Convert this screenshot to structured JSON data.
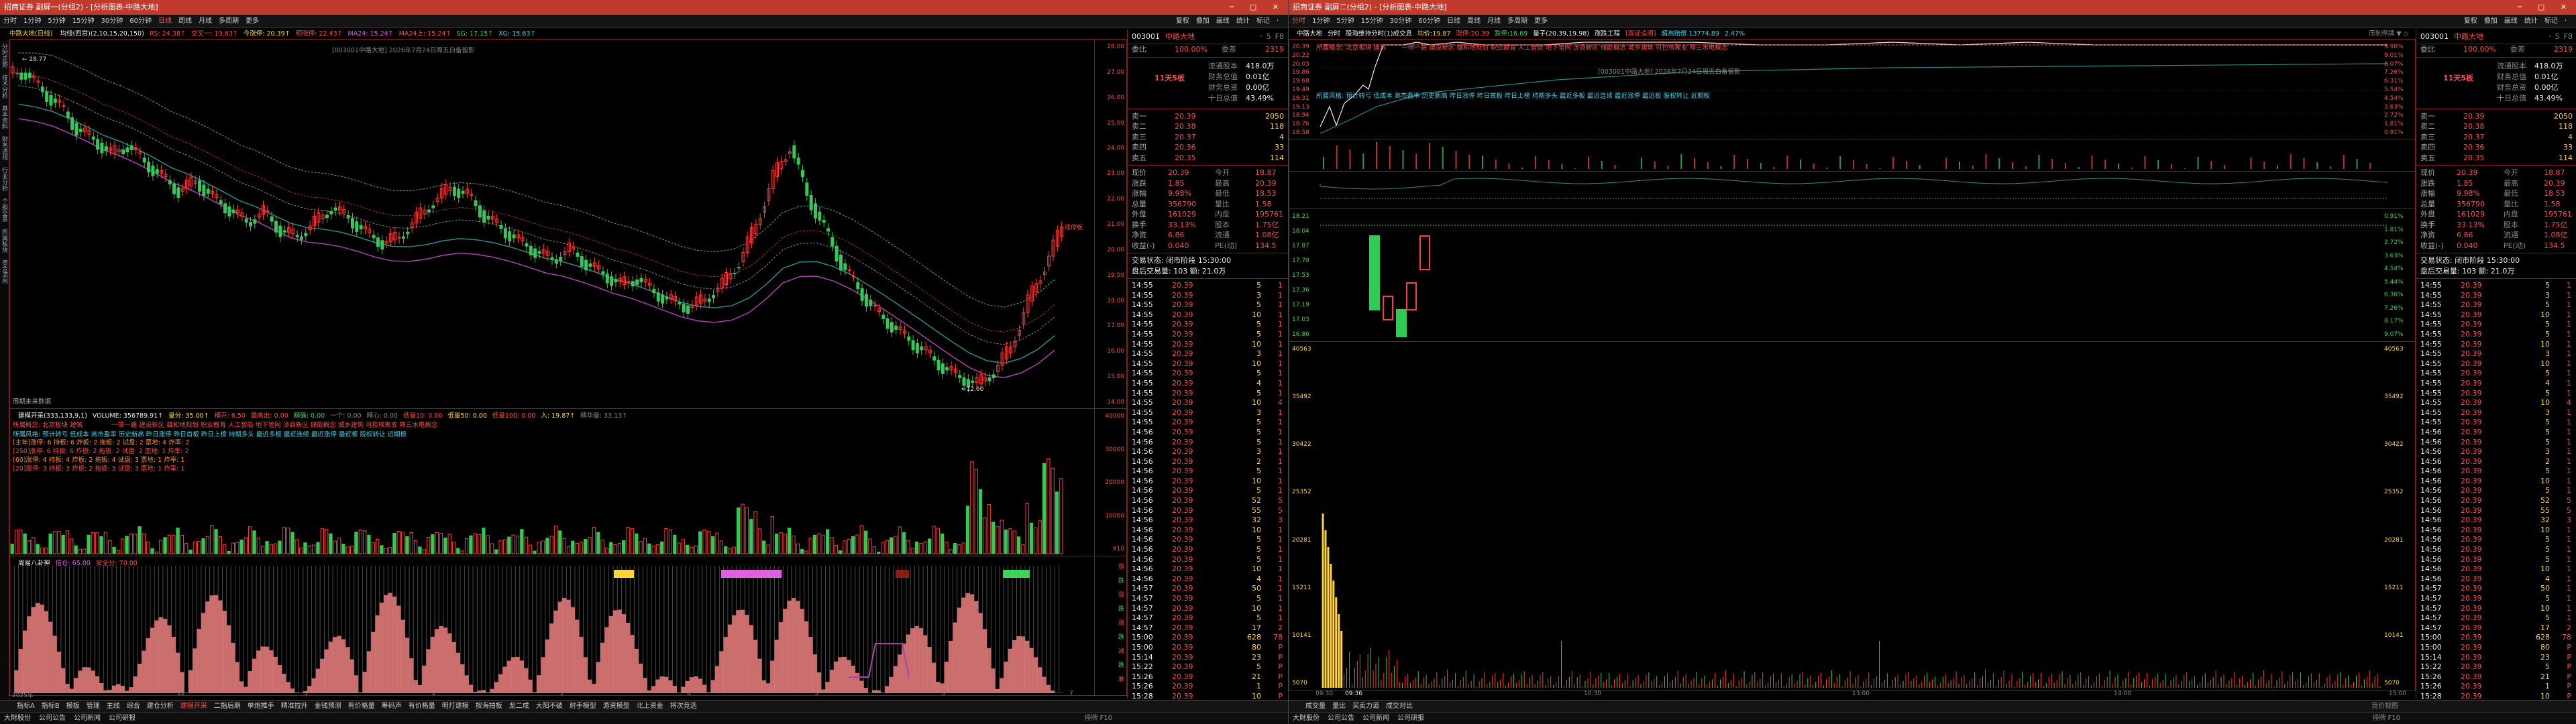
{
  "left": {
    "title": "招商证券 副屏一(分组2) - [分析图表-中路大地]",
    "menu": [
      "分时",
      "1分钟",
      "5分钟",
      "15分钟",
      "30分钟",
      "60分钟",
      "日线",
      "周线",
      "月线",
      "多周期",
      "更多"
    ],
    "menu_active": "日线",
    "menu_right": [
      "复权",
      "叠加",
      "画线",
      "统计",
      "标记",
      "·"
    ],
    "stock_label": "中路大地(日线)",
    "ind_line": [
      {
        "t": "均线(四宫)(2,10,15,20,150)",
        "c": "wht"
      },
      {
        "t": "RS: 24.38↑",
        "c": "red"
      },
      {
        "t": "交叉一: 19.63↑",
        "c": "red"
      },
      {
        "t": "今涨停: 20.39↑",
        "c": "yel"
      },
      {
        "t": "明涨停: 22.43↑",
        "c": "red"
      },
      {
        "t": "MA24: 15.24↑",
        "c": "mag"
      },
      {
        "t": "MA24上: 15.24↑",
        "c": "red"
      },
      {
        "t": "SG: 17.15↑",
        "c": "grn"
      },
      {
        "t": "XG: 15.63↑",
        "c": "cy"
      }
    ],
    "watermark": "[003001中路大地] 2026年7月24日周五白备留影",
    "high_marker": "28.77",
    "low_marker": "12.60",
    "right_marker": "涨停板",
    "no_data": "周期未来数据",
    "price_axis": [
      "28.00",
      "27.00",
      "26.00",
      "25.00",
      "24.00",
      "23.00",
      "22.00",
      "21.00",
      "20.00",
      "19.00",
      "18.00",
      "17.00",
      "16.00",
      "15.00",
      "14.00"
    ],
    "vol_header": [
      {
        "t": "建模开采(333,133,9,1)",
        "c": "wht"
      },
      {
        "t": "VOLUME: 356789.91↑",
        "c": "wht"
      },
      {
        "t": "量分: 35.00↑",
        "c": "yel"
      },
      {
        "t": "横开: 6.50",
        "c": "red"
      },
      {
        "t": "最高出: 0.00",
        "c": "red"
      },
      {
        "t": "精确: 0.00",
        "c": "grn"
      },
      {
        "t": "一个: 0.00",
        "c": "grey"
      },
      {
        "t": "精心: 0.00",
        "c": "grey"
      },
      {
        "t": "低量10: 0.00",
        "c": "red"
      },
      {
        "t": "低量50: 0.00",
        "c": "yel"
      },
      {
        "t": "低量100: 0.00",
        "c": "red"
      },
      {
        "t": "入: 19.87↑",
        "c": "yel"
      },
      {
        "t": "精华量: 33.13↑",
        "c": "grey"
      }
    ],
    "concept_line1": "所属概念: 北京板块   建筑",
    "concept_line1b": "一带一路 建设新区 雄和地规划 职业教育 人工智能 地下管网 涉县新区 储能概念 城乡建筑 可控核聚变 降三水电概念",
    "concept_line2": "所属风格: 预计转亏 低成本 高市盈率 历史新高 昨日涨停 昨日首板 昨日上榜 持期多头 最近多板 最近连续 最近涨停 最近板 股权转让 近期板",
    "stats_rows": [
      "[主年]涨停: 6  持板: 6  炸板: 2  拖板: 2  试盘: 2  票地: 4  炸率: 2",
      "[250]涨停: 6  持板: 6  炸板: 2  拖板: 2  试盘: 2  票地: 1  炸率: 2",
      "[60]涨停: 4  持板: 4  炸板: 2  拖板: 4  试盘: 3  票地: 1  炸率: 1",
      "[20]涨停: 3  持板: 3  炸板: 2  拖板: 3  试盘: 3  票地: 1  炸率: 1"
    ],
    "vol_axis": [
      "40000",
      "30000",
      "20000",
      "10000",
      "X10"
    ],
    "osc_header": [
      {
        "t": "周易八卦神",
        "c": "wht"
      },
      {
        "t": "信仓: 65.00",
        "c": "mag"
      },
      {
        "t": "安全分: 70.00",
        "c": "red"
      }
    ],
    "osc_side_labels": [
      "涨",
      "跌",
      "涨",
      "跌",
      "涨",
      "跌",
      "减",
      "跌",
      "准"
    ],
    "date_axis": [
      "2025年",
      "12",
      "1",
      "2",
      "3",
      "4",
      "5",
      "6",
      "7"
    ],
    "bottom_tabs": [
      "指标A",
      "指标B",
      "模板",
      "管理",
      "主线",
      "综合",
      "建仓分析",
      "建模开采",
      "二指后期",
      "单炮推手",
      "精准拉升",
      "金钱预测",
      "有价格量",
      "筹码声",
      "有价格量",
      "明灯建模",
      "按海拍板",
      "龙二成",
      "大阳不破",
      "射手模型",
      "游资模型",
      "北上资金",
      "将次竞选"
    ],
    "bottom_active": "建模开采",
    "status": [
      "大財股份",
      "公司公告",
      "公司新闻",
      "公司研报"
    ],
    "status_right": "停牌  F10",
    "right_panel": {
      "code": "003001",
      "name": "中路大地",
      "side_tags": [
        "·",
        "5",
        "F8"
      ],
      "row1": {
        "label": "委比",
        "value": "100.00%",
        "label2": "委差",
        "value2": "2319"
      },
      "stock_title": "11天5板",
      "stock_info": [
        [
          "流通股本",
          "418.0万"
        ],
        [
          "财务总值",
          "0.01亿"
        ],
        [
          "财务总资",
          "0.00亿"
        ],
        [
          "十日总值",
          "43.49%"
        ]
      ],
      "asks": [
        [
          "卖一",
          "20.39",
          "2050"
        ],
        [
          "卖二",
          "20.38",
          "118"
        ],
        [
          "卖三",
          "20.37",
          "4"
        ],
        [
          "卖四",
          "20.36",
          "33"
        ],
        [
          "卖五",
          "20.35",
          "114"
        ]
      ],
      "quote": [
        [
          "现价",
          "20.39",
          "今开",
          "18.87"
        ],
        [
          "涨跌",
          "1.85",
          "最高",
          "20.39"
        ],
        [
          "涨幅",
          "9.98%",
          "最低",
          "18.53"
        ],
        [
          "总量",
          "356790",
          "量比",
          "1.58"
        ],
        [
          "外盘",
          "161029",
          "内盘",
          "195761"
        ],
        [
          "换手",
          "33.13%",
          "股本",
          "1.75亿"
        ],
        [
          "净资",
          "6.86",
          "流通",
          "1.08亿"
        ],
        [
          "收益(-)",
          "0.040",
          "PE(动)",
          "134.5"
        ]
      ],
      "trade_status": "交易状态: 闭市阶段 15:30:00",
      "after_hours": "盘后交易量: 103   额: 21.0万",
      "ticks": [
        [
          "14:55",
          "20.39",
          "5",
          "1"
        ],
        [
          "14:55",
          "20.39",
          "3",
          "1"
        ],
        [
          "14:55",
          "20.39",
          "5",
          "1"
        ],
        [
          "14:55",
          "20.39",
          "10",
          "1"
        ],
        [
          "14:55",
          "20.39",
          "5",
          "1"
        ],
        [
          "14:55",
          "20.39",
          "5",
          "1"
        ],
        [
          "14:55",
          "20.39",
          "10",
          "1"
        ],
        [
          "14:55",
          "20.39",
          "3",
          "1"
        ],
        [
          "14:55",
          "20.39",
          "10",
          "1"
        ],
        [
          "14:55",
          "20.39",
          "5",
          "1"
        ],
        [
          "14:55",
          "20.39",
          "4",
          "1"
        ],
        [
          "14:55",
          "20.39",
          "5",
          "1"
        ],
        [
          "14:55",
          "20.39",
          "10",
          "4"
        ],
        [
          "14:55",
          "20.39",
          "3",
          "1"
        ],
        [
          "14:55",
          "20.39",
          "5",
          "1"
        ],
        [
          "14:56",
          "20.39",
          "5",
          "1"
        ],
        [
          "14:56",
          "20.39",
          "5",
          "1"
        ],
        [
          "14:56",
          "20.39",
          "3",
          "1"
        ],
        [
          "14:56",
          "20.39",
          "2",
          "1"
        ],
        [
          "14:56",
          "20.39",
          "5",
          "1"
        ],
        [
          "14:56",
          "20.39",
          "10",
          "1"
        ],
        [
          "14:56",
          "20.39",
          "5",
          "1"
        ],
        [
          "14:56",
          "20.39",
          "52",
          "5"
        ],
        [
          "14:56",
          "20.39",
          "55",
          "5"
        ],
        [
          "14:56",
          "20.39",
          "32",
          "3"
        ],
        [
          "14:56",
          "20.39",
          "10",
          "1"
        ],
        [
          "14:56",
          "20.39",
          "5",
          "1"
        ],
        [
          "14:56",
          "20.39",
          "5",
          "1"
        ],
        [
          "14:56",
          "20.39",
          "5",
          "1"
        ],
        [
          "14:56",
          "20.39",
          "10",
          "1"
        ],
        [
          "14:56",
          "20.39",
          "4",
          "1"
        ],
        [
          "14:57",
          "20.39",
          "50",
          "1"
        ],
        [
          "14:57",
          "20.39",
          "5",
          "1"
        ],
        [
          "14:57",
          "20.39",
          "10",
          "1"
        ],
        [
          "14:57",
          "20.39",
          "5",
          "1"
        ],
        [
          "14:57",
          "20.39",
          "17",
          "2"
        ],
        [
          "15:00",
          "20.39",
          "628",
          "78"
        ],
        [
          "15:00",
          "20.39",
          "80",
          "P"
        ],
        [
          "15:14",
          "20.39",
          "23",
          "P"
        ],
        [
          "15:22",
          "20.39",
          "5",
          "P"
        ],
        [
          "15:26",
          "20.39",
          "21",
          "P"
        ],
        [
          "15:26",
          "20.39",
          "1",
          "P"
        ],
        [
          "15:28",
          "20.39",
          "10",
          "P"
        ],
        [
          "15:28",
          "20.39",
          "5",
          "P"
        ],
        [
          "15:28",
          "20.39",
          "4",
          "P"
        ]
      ]
    }
  },
  "right": {
    "title": "招商证券 副屏二(分组2) - [分析图表-中路大地]",
    "menu": [
      "分时",
      "1分钟",
      "5分钟",
      "15分钟",
      "30分钟",
      "60分钟",
      "日线",
      "周线",
      "月线",
      "多周期",
      "更多"
    ],
    "menu_active": "分时",
    "menu_right": [
      "复权",
      "叠加",
      "画线",
      "统计",
      "标记",
      "·"
    ],
    "ind_line": [
      {
        "t": "中路大地",
        "c": "wht"
      },
      {
        "t": "分时",
        "c": "wht"
      },
      {
        "t": "股海维持分时(1)成交息",
        "c": "wht"
      },
      {
        "t": "均价:19.87",
        "c": "yel"
      },
      {
        "t": "涨停:20.39",
        "c": "red"
      },
      {
        "t": "跌停:16.69",
        "c": "grn"
      },
      {
        "t": "量子(20.39,19.98)",
        "c": "wht"
      },
      {
        "t": "涨跌工程",
        "c": "wht"
      },
      {
        "t": "[双证追溯]",
        "c": "red"
      },
      {
        "t": "超高赔偿 13774.89",
        "c": "cy"
      },
      {
        "t": "2.47%",
        "c": "cy"
      }
    ],
    "ind_right": "压制停牌 ▼ ◇",
    "concept_line": "所属概念: 北京板块   建筑",
    "concept_line1b": "一带一路 建设新区 雄和地规划 职业教育 人工智能 地下管网 涉县新区 储能概念 城乡建筑 可控核聚变 降三水电概念",
    "concept_line2": "所属风格: 预计转亏 低成本 高市盈率 历史新高 昨日涨停 昨日首板 昨日上榜 持期多头 最近多板 最近连续 最近涨停 最近板 股权转让 近期板",
    "watermark": "[003001中路大地] 2026年7月24日周五白备留影",
    "price_axis_left": [
      "20.39",
      "20.22",
      "20.03",
      "19.86",
      "19.68",
      "19.49",
      "19.31",
      "19.13",
      "18.94",
      "18.76",
      "18.58"
    ],
    "pct_axis_right": [
      "9.98%",
      "9.01%",
      "8.07%",
      "7.26%",
      "6.31%",
      "5.54%",
      "4.54%",
      "3.63%",
      "2.72%",
      "1.81%",
      "0.91%"
    ],
    "mid_axis_left": [
      "18.21",
      "18.04",
      "17.87",
      "17.70",
      "17.53",
      "17.36",
      "17.19",
      "17.03",
      "16.86"
    ],
    "mid_axis_right": [
      "0.91%",
      "1.81%",
      "2.72%",
      "3.63%",
      "4.54%",
      "5.44%",
      "6.36%",
      "7.26%",
      "8.17%",
      "9.07%"
    ],
    "dotted_value": "18.04",
    "vol_axis_left": [
      "40563",
      "35492",
      "30422",
      "25352",
      "20281",
      "15211",
      "10141",
      "5070"
    ],
    "vol_axis_right": [
      "40563",
      "35492",
      "30422",
      "25352",
      "20281",
      "15211",
      "10141",
      "5070"
    ],
    "time_axis": [
      "09:30",
      "09:36",
      "10:30",
      "13:00",
      "14:00",
      "15:00"
    ],
    "bottom_tabs": [
      "成交量",
      "量比",
      "买卖力道",
      "成交对比"
    ],
    "bottom_right_tag": "竞价视图",
    "status": [
      "大財股份",
      "公司公告",
      "公司新闻",
      "公司研报"
    ],
    "status_right": "停牌  F10",
    "sub_header": "区间成交 15:30:00"
  },
  "chart_data": [
    {
      "type": "candlestick",
      "title": "中路大地(日线)",
      "ylim": [
        12.6,
        28.77
      ],
      "x": [
        "2025年",
        "12",
        "1",
        "2",
        "3",
        "4",
        "5",
        "6",
        "7"
      ],
      "close_series": [
        27.8,
        26.9,
        26.2,
        25.1,
        24.6,
        23.9,
        24.3,
        23.5,
        22.8,
        22.1,
        22.6,
        21.8,
        21.2,
        20.6,
        21.1,
        20.2,
        19.9,
        20.6,
        21.3,
        20.8,
        20.1,
        19.6,
        19.9,
        20.8,
        21.6,
        22.3,
        21.9,
        20.9,
        20.3,
        19.7,
        19.2,
        18.8,
        19.3,
        18.6,
        18.1,
        17.6,
        17.9,
        17.2,
        16.8,
        16.5,
        16.9,
        17.6,
        18.7,
        20.5,
        22.8,
        24.3,
        21.9,
        20.3,
        18.6,
        17.4,
        16.3,
        15.6,
        14.9,
        14.3,
        13.6,
        13.1,
        12.8,
        13.4,
        14.6,
        16.8,
        18.5,
        20.39
      ],
      "high": 28.77,
      "low": 12.6,
      "last": 20.39
    },
    {
      "type": "line",
      "title": "中路大地 分时",
      "ylim": [
        18.58,
        20.39
      ],
      "x": [
        "09:30",
        "10:30",
        "13:00",
        "14:00",
        "15:00"
      ],
      "price": [
        18.87,
        18.7,
        19.2,
        19.4,
        19.6,
        19.8,
        20.1,
        20.39,
        20.39,
        20.39,
        20.39,
        20.39,
        20.39,
        20.39,
        20.39,
        20.39,
        20.39,
        20.39,
        20.39,
        20.39
      ],
      "avg_price": 19.87
    }
  ]
}
